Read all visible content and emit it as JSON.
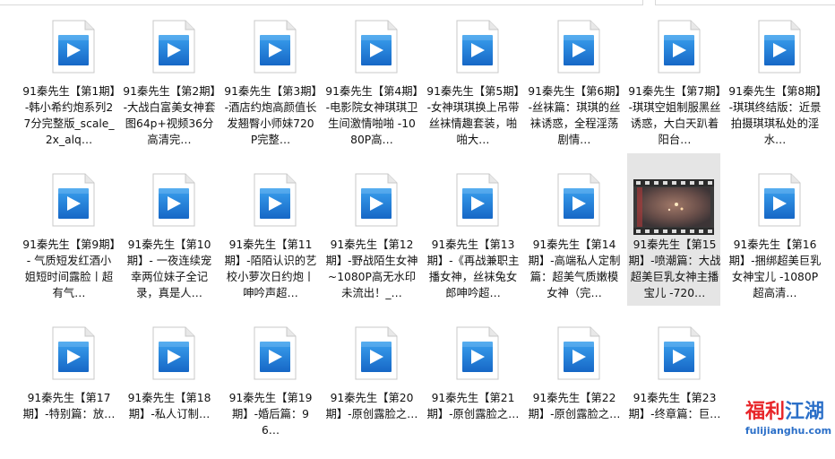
{
  "files": [
    {
      "label": "91秦先生【第1期】-韩小希约炮系列27分完整版_scale_2x_alq…",
      "type": "media"
    },
    {
      "label": "91秦先生【第2期】-大战白富美女神套图64p+视频36分高清完…",
      "type": "media"
    },
    {
      "label": "91秦先生【第3期】-酒店约炮高颜值长发翘臀小师妹720P完整…",
      "type": "media"
    },
    {
      "label": "91秦先生【第4期】-电影院女神琪琪卫生间激情啪啪 -1080P高…",
      "type": "media"
    },
    {
      "label": "91秦先生【第5期】-女神琪琪换上吊带丝袜情趣套装，啪啪大…",
      "type": "media"
    },
    {
      "label": "91秦先生【第6期】-丝袜篇：琪琪的丝袜诱惑，全程淫荡剧情…",
      "type": "media"
    },
    {
      "label": "91秦先生【第7期】-琪琪空姐制服黑丝诱惑，大白天趴着阳台…",
      "type": "media"
    },
    {
      "label": "91秦先生【第8期】-琪琪终结版：近景拍摄琪琪私处的淫水…",
      "type": "media"
    },
    {
      "label": "91秦先生【第9期】- 气质短发红酒小姐短时间露脸丨超有气…",
      "type": "media"
    },
    {
      "label": "91秦先生【第10期】- 一夜连续宠幸两位妹子全记录，真是人…",
      "type": "media"
    },
    {
      "label": "91秦先生【第11期】-陌陌认识的艺校小萝次日约炮丨呻吟声超…",
      "type": "media"
    },
    {
      "label": "91秦先生【第12期】-野战陌生女神 ~1080P高无水印未流出！_…",
      "type": "media"
    },
    {
      "label": "91秦先生【第13期】-《再战兼职主播女神，丝袜兔女郎呻吟超…",
      "type": "media"
    },
    {
      "label": "91秦先生【第14期】-高端私人定制篇：超美气质嫩模女神（完…",
      "type": "media"
    },
    {
      "label": "91秦先生【第15期】-喷潮篇：大战超美巨乳女神主播宝儿 -720…",
      "type": "video",
      "selected": true
    },
    {
      "label": "91秦先生【第16期】-捆绑超美巨乳女神宝儿 -1080P超高清…",
      "type": "media"
    },
    {
      "label": "91秦先生【第17期】-特别篇：放…",
      "type": "media"
    },
    {
      "label": "91秦先生【第18期】-私人订制…",
      "type": "media"
    },
    {
      "label": "91秦先生【第19期】-婚后篇：96…",
      "type": "media"
    },
    {
      "label": "91秦先生【第20期】-原创露脸之…",
      "type": "media"
    },
    {
      "label": "91秦先生【第21期】-原创露脸之…",
      "type": "media"
    },
    {
      "label": "91秦先生【第22期】-原创露脸之…",
      "type": "media"
    },
    {
      "label": "91秦先生【第23期】-终章篇：巨…",
      "type": "media"
    }
  ],
  "watermark": {
    "logo_red": "福利",
    "logo_blue": "江湖",
    "url": "fulijianghu.com"
  },
  "colors": {
    "icon_blue": "#1e78d7",
    "icon_light": "#5ab0f2",
    "selected_bg": "#e5e5e5"
  }
}
